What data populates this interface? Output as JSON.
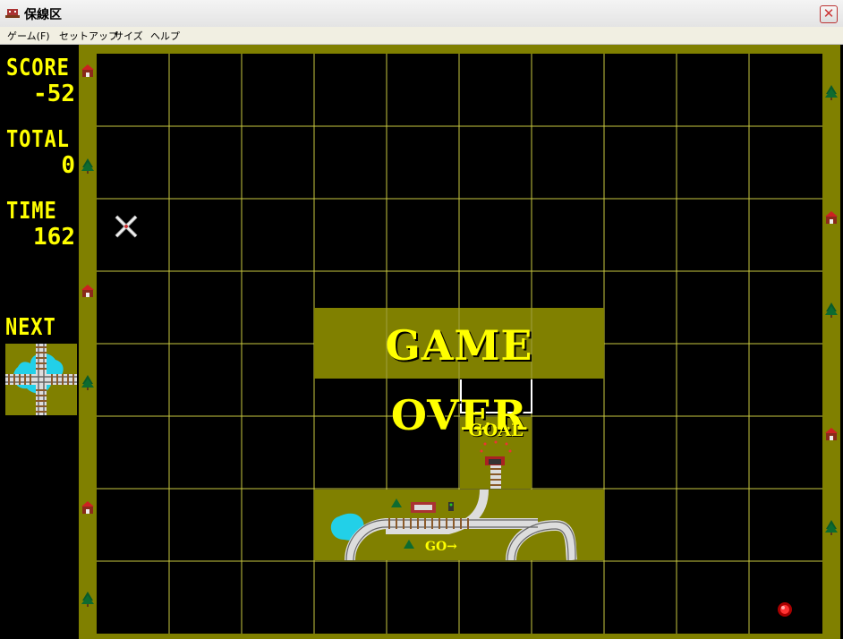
{
  "window": {
    "title": "保線区",
    "close_glyph": "✕"
  },
  "menu": {
    "items": [
      "ゲーム(F)",
      "セットアップ",
      "サイズ",
      "ヘルプ"
    ]
  },
  "hud": {
    "score_label": "SCORE",
    "score_value": "-52",
    "total_label": "TOTAL",
    "total_value": "0",
    "time_label": "TIME",
    "time_value": "162",
    "next_label": "NEXT"
  },
  "board": {
    "game_over_text": "GAME OVER",
    "goal_label": "GOAL",
    "start_label": "GO→"
  },
  "colors": {
    "text": "#ffff00",
    "tile": "#808000",
    "grid_line": "#c8c840",
    "background": "#000000"
  }
}
